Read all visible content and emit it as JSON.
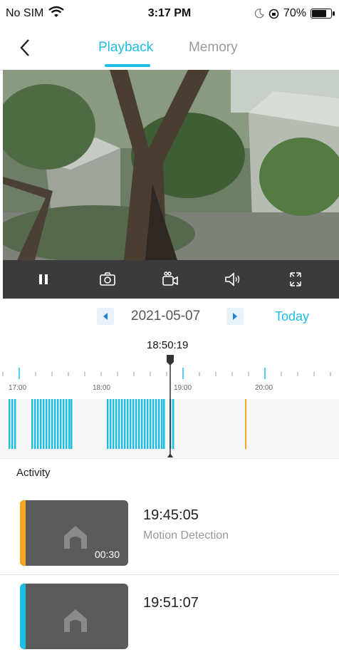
{
  "status_bar": {
    "carrier": "No SIM",
    "time": "3:17 PM",
    "battery": "70%",
    "battery_level": 0.7
  },
  "nav": {
    "tabs": [
      {
        "label": "Playback",
        "active": true
      },
      {
        "label": "Memory",
        "active": false
      }
    ]
  },
  "player": {
    "controls": [
      "pause-icon",
      "snapshot-camera-icon",
      "record-video-icon",
      "speaker-icon",
      "fullscreen-icon"
    ]
  },
  "date_bar": {
    "date": "2021-05-07",
    "today_label": "Today"
  },
  "timeline": {
    "current_time": "18:50:19",
    "labels": [
      "17:00",
      "18:00",
      "19:00",
      "20:00"
    ],
    "accent": "#1fbde3",
    "alert_color": "#f5a623"
  },
  "activity": {
    "title": "Activity",
    "events": [
      {
        "time": "19:45:05",
        "type": "Motion Detection",
        "duration": "00:30",
        "color": "#f5a623"
      },
      {
        "time": "19:51:07",
        "type": "",
        "duration": "",
        "color": "#1fbde3"
      }
    ]
  }
}
